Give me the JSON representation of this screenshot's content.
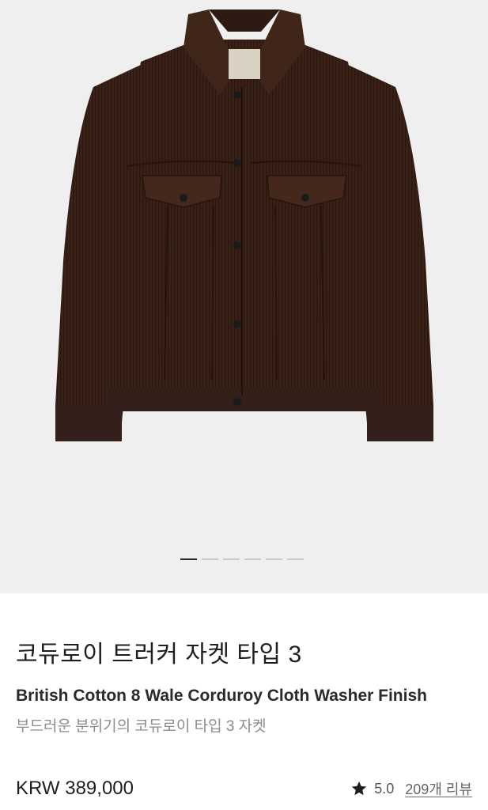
{
  "product": {
    "title_ko": "코듀로이 트러커 자켓 타입 3",
    "title_en": "British Cotton 8 Wale Corduroy Cloth Washer Finish",
    "description": "부드러운 분위기의 코듀로이 타입 3 자켓",
    "price": "KRW 389,000",
    "rating": "5.0",
    "reviews_link": "209개 리뷰"
  },
  "gallery": {
    "image_count": 6,
    "active_index": 0
  },
  "colors": {
    "jacket": "#3b2218",
    "background": "#efeff0",
    "active_dot": "#2a2a2a"
  }
}
